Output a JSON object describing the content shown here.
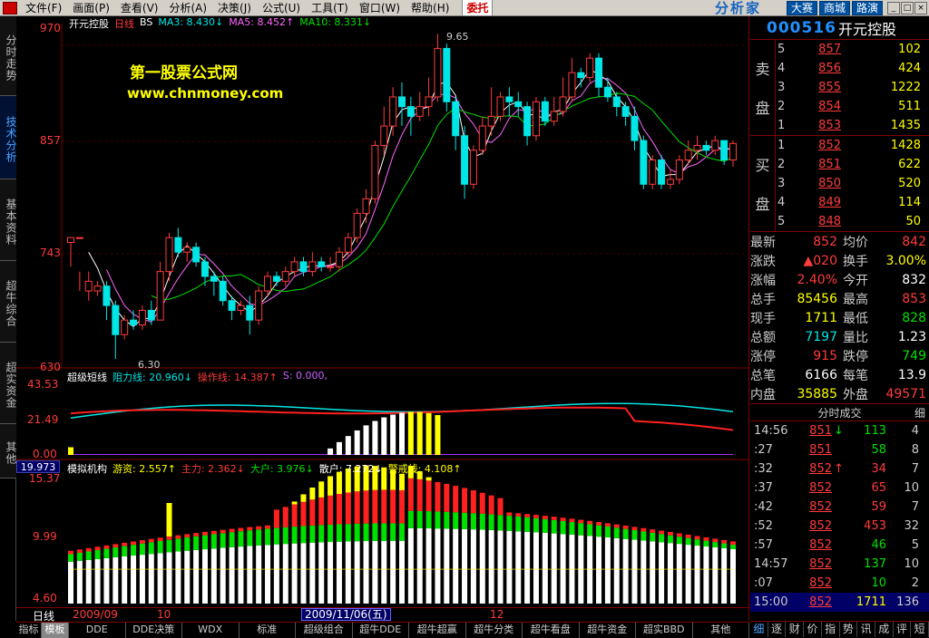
{
  "menu": {
    "items": [
      "文件(F)",
      "画面(P)",
      "查看(V)",
      "分析(A)",
      "决策(J)",
      "公式(U)",
      "工具(T)",
      "窗口(W)",
      "帮助(H)"
    ],
    "trade": "委托",
    "brand": "分析家",
    "buttons": [
      "大赛",
      "商城",
      "路演"
    ]
  },
  "left_tabs": [
    "分时走势",
    "技术分析",
    "基本资料",
    "超牛综合",
    "超实资金",
    "其他"
  ],
  "header": {
    "name": "开元控股",
    "period": "日线",
    "bs": "BS",
    "ma3": "MA3: 8.430↓",
    "ma5": "MA5: 8.452↑",
    "ma10": "MA10: 8.331↓",
    "ma3_color": "#ffffff",
    "ma5_color": "#ff66ff",
    "ma10_color": "#00e000"
  },
  "watermark": {
    "title": "第一股票公式网",
    "url": "www.chnmoney.com"
  },
  "price_axis": [
    "970",
    "857",
    "743",
    "630"
  ],
  "annotations": {
    "high": "9.65",
    "low": "6.30"
  },
  "panel2": {
    "name": "超级短线",
    "l1": "阻力线: 20.960↓",
    "l2": "操作线: 14.387↑",
    "l3": "S: 0.000,",
    "axis": [
      "43.53",
      "21.49",
      "0.00"
    ]
  },
  "panel3": {
    "value_box": "19.973",
    "name": "模拟机构",
    "l1": "游资: 2.557↑",
    "l2": "主力: 2.362↓",
    "l3": "大户: 3.976↓",
    "l4": "散户: 7.272↓",
    "l5": "警戒线: 4.108↑",
    "axis": [
      "15.37",
      "9.99",
      "4.60"
    ]
  },
  "date_bar": {
    "period": "日线",
    "m1": "2009/09",
    "m2": "10",
    "date": "2009/11/06(五)",
    "m3": "12"
  },
  "bottom_tabs": [
    "指标",
    "模板",
    "DDE",
    "DDE决策",
    "WDX",
    "标准",
    "超级组合",
    "超牛DDE",
    "超牛超赢",
    "超牛分类",
    "超牛看盘",
    "超牛资金",
    "超实BBD",
    "其他"
  ],
  "stock": {
    "code": "000516",
    "name": "开元控股"
  },
  "sell_label": [
    "卖",
    "盘"
  ],
  "buy_label": [
    "买",
    "盘"
  ],
  "asks": [
    {
      "lv": "5",
      "p": "857",
      "v": "102"
    },
    {
      "lv": "4",
      "p": "856",
      "v": "424"
    },
    {
      "lv": "3",
      "p": "855",
      "v": "1222"
    },
    {
      "lv": "2",
      "p": "854",
      "v": "511"
    },
    {
      "lv": "1",
      "p": "853",
      "v": "1435"
    }
  ],
  "bids": [
    {
      "lv": "1",
      "p": "852",
      "v": "1428"
    },
    {
      "lv": "2",
      "p": "851",
      "v": "622"
    },
    {
      "lv": "3",
      "p": "850",
      "v": "520"
    },
    {
      "lv": "4",
      "p": "849",
      "v": "114"
    },
    {
      "lv": "5",
      "p": "848",
      "v": "50"
    }
  ],
  "quote": [
    {
      "k": "最新",
      "v": "852",
      "vc": "red",
      "k2": "均价",
      "v2": "842",
      "v2c": "red"
    },
    {
      "k": "涨跌",
      "v": "▲020",
      "vc": "red",
      "k2": "换手",
      "v2": "3.00%",
      "v2c": "yel"
    },
    {
      "k": "涨幅",
      "v": "2.40%",
      "vc": "red",
      "k2": "今开",
      "v2": "832",
      "v2c": "wht"
    },
    {
      "k": "总手",
      "v": "85456",
      "vc": "yel",
      "k2": "最高",
      "v2": "853",
      "v2c": "red"
    },
    {
      "k": "现手",
      "v": "1711",
      "vc": "yel",
      "k2": "最低",
      "v2": "828",
      "v2c": "grn"
    },
    {
      "k": "总额",
      "v": "7197",
      "vc": "cyn",
      "k2": "量比",
      "v2": "1.23",
      "v2c": "wht"
    },
    {
      "k": "涨停",
      "v": "915",
      "vc": "red",
      "k2": "跌停",
      "v2": "749",
      "v2c": "grn"
    },
    {
      "k": "总笔",
      "v": "6166",
      "vc": "wht",
      "k2": "每笔",
      "v2": "13.9",
      "v2c": "wht"
    },
    {
      "k": "内盘",
      "v": "35885",
      "vc": "yel",
      "k2": "外盘",
      "v2": "49571",
      "v2c": "red"
    }
  ],
  "ticks_header": "分时成交",
  "ticks_detail": "细",
  "ticks": [
    {
      "t": "14:56",
      "p": "851",
      "ar": "↓",
      "arc": "grn",
      "v": "113",
      "vc": "grn",
      "n": "4"
    },
    {
      "t": ":27",
      "p": "851",
      "ar": "",
      "arc": "",
      "v": "58",
      "vc": "grn",
      "n": "8"
    },
    {
      "t": ":32",
      "p": "852",
      "ar": "↑",
      "arc": "red",
      "v": "34",
      "vc": "red",
      "n": "7"
    },
    {
      "t": ":37",
      "p": "852",
      "ar": "",
      "arc": "",
      "v": "65",
      "vc": "red",
      "n": "10"
    },
    {
      "t": ":42",
      "p": "852",
      "ar": "",
      "arc": "",
      "v": "59",
      "vc": "red",
      "n": "7"
    },
    {
      "t": ":52",
      "p": "852",
      "ar": "",
      "arc": "",
      "v": "453",
      "vc": "red",
      "n": "32"
    },
    {
      "t": ":57",
      "p": "852",
      "ar": "",
      "arc": "",
      "v": "46",
      "vc": "grn",
      "n": "5"
    },
    {
      "t": "14:57",
      "p": "852",
      "ar": "",
      "arc": "",
      "v": "137",
      "vc": "grn",
      "n": "10"
    },
    {
      "t": ":07",
      "p": "852",
      "ar": "",
      "arc": "",
      "v": "10",
      "vc": "grn",
      "n": "2"
    },
    {
      "t": "15:00",
      "p": "852",
      "ar": "",
      "arc": "",
      "v": "1711",
      "vc": "yel",
      "n": "136"
    }
  ],
  "right_tabs": [
    "细",
    "逐",
    "财",
    "价",
    "指",
    "势",
    "讯",
    "成",
    "评",
    "短"
  ],
  "chart_data": {
    "type": "candlestick",
    "price_range": [
      6.3,
      9.7
    ],
    "candles": [
      [
        7.5,
        7.55,
        7.25,
        7.55
      ],
      [
        7.55,
        7.55,
        7.2,
        7.0
      ],
      [
        7.0,
        7.1,
        6.9,
        7.2
      ],
      [
        7.0,
        7.05,
        6.95,
        7.1
      ],
      [
        7.05,
        6.85,
        6.7,
        7.1
      ],
      [
        6.85,
        6.55,
        6.3,
        6.9
      ],
      [
        6.55,
        6.7,
        6.5,
        6.75
      ],
      [
        6.7,
        6.65,
        6.6,
        6.8
      ],
      [
        6.65,
        6.8,
        6.6,
        6.85
      ],
      [
        6.8,
        6.7,
        6.65,
        6.9
      ],
      [
        6.7,
        7.2,
        6.7,
        7.3
      ],
      [
        7.2,
        7.55,
        7.1,
        7.6
      ],
      [
        7.55,
        7.4,
        7.35,
        7.65
      ],
      [
        7.4,
        7.45,
        7.3,
        7.5
      ],
      [
        7.45,
        7.3,
        7.25,
        7.5
      ],
      [
        7.3,
        7.15,
        7.05,
        7.35
      ],
      [
        7.15,
        7.1,
        6.95,
        7.2
      ],
      [
        7.1,
        6.9,
        6.85,
        7.15
      ],
      [
        6.9,
        6.8,
        6.7,
        6.95
      ],
      [
        6.8,
        6.85,
        6.75,
        6.9
      ],
      [
        6.85,
        6.7,
        6.55,
        6.95
      ],
      [
        6.7,
        7.0,
        6.65,
        7.05
      ],
      [
        7.0,
        7.15,
        6.95,
        7.2
      ],
      [
        7.15,
        7.1,
        7.05,
        7.2
      ],
      [
        7.1,
        7.2,
        7.05,
        7.25
      ],
      [
        7.2,
        7.3,
        7.15,
        7.35
      ],
      [
        7.3,
        7.2,
        7.15,
        7.35
      ],
      [
        7.2,
        7.3,
        7.15,
        7.4
      ],
      [
        7.3,
        7.25,
        7.2,
        7.35
      ],
      [
        7.25,
        7.25,
        7.2,
        7.35
      ],
      [
        7.25,
        7.4,
        7.2,
        7.45
      ],
      [
        7.4,
        7.55,
        7.35,
        7.6
      ],
      [
        7.55,
        7.8,
        7.5,
        7.85
      ],
      [
        7.8,
        7.95,
        7.7,
        8.05
      ],
      [
        7.95,
        8.5,
        7.9,
        8.55
      ],
      [
        8.5,
        8.7,
        8.4,
        8.9
      ],
      [
        8.7,
        9.0,
        8.6,
        9.1
      ],
      [
        9.0,
        8.9,
        8.7,
        9.15
      ],
      [
        8.9,
        8.8,
        8.6,
        9.0
      ],
      [
        8.8,
        8.9,
        8.75,
        9.05
      ],
      [
        8.9,
        9.0,
        8.8,
        9.2
      ],
      [
        9.0,
        9.5,
        8.95,
        9.65
      ],
      [
        9.5,
        8.95,
        8.85,
        9.55
      ],
      [
        8.95,
        8.6,
        8.45,
        9.0
      ],
      [
        8.6,
        8.1,
        7.95,
        8.7
      ],
      [
        8.1,
        8.45,
        8.05,
        8.5
      ],
      [
        8.45,
        8.7,
        8.4,
        8.8
      ],
      [
        8.7,
        8.8,
        8.6,
        9.1
      ],
      [
        8.8,
        9.0,
        8.75,
        9.05
      ],
      [
        9.0,
        8.95,
        8.8,
        9.1
      ],
      [
        8.95,
        8.9,
        8.8,
        9.05
      ],
      [
        8.9,
        8.6,
        8.5,
        8.95
      ],
      [
        8.6,
        8.95,
        8.55,
        9.0
      ],
      [
        8.95,
        8.75,
        8.7,
        9.0
      ],
      [
        8.75,
        8.85,
        8.7,
        9.0
      ],
      [
        8.85,
        9.0,
        8.8,
        9.2
      ],
      [
        9.0,
        9.25,
        8.95,
        9.4
      ],
      [
        9.25,
        9.2,
        9.1,
        9.3
      ],
      [
        9.2,
        9.4,
        9.15,
        9.45
      ],
      [
        9.4,
        9.1,
        9.0,
        9.45
      ],
      [
        9.1,
        9.0,
        8.95,
        9.2
      ],
      [
        9.0,
        8.9,
        8.8,
        9.05
      ],
      [
        8.9,
        8.8,
        8.7,
        8.95
      ],
      [
        8.8,
        8.55,
        8.45,
        8.9
      ],
      [
        8.55,
        8.1,
        8.05,
        8.6
      ],
      [
        8.1,
        8.35,
        8.05,
        8.4
      ],
      [
        8.35,
        8.1,
        8.05,
        8.4
      ],
      [
        8.1,
        8.15,
        8.05,
        8.25
      ],
      [
        8.15,
        8.35,
        8.1,
        8.4
      ],
      [
        8.35,
        8.45,
        8.3,
        8.55
      ],
      [
        8.45,
        8.5,
        8.35,
        8.6
      ],
      [
        8.5,
        8.45,
        8.4,
        8.55
      ],
      [
        8.45,
        8.55,
        8.4,
        8.6
      ],
      [
        8.55,
        8.35,
        8.3,
        8.55
      ],
      [
        8.35,
        8.52,
        8.28,
        8.55
      ]
    ]
  }
}
